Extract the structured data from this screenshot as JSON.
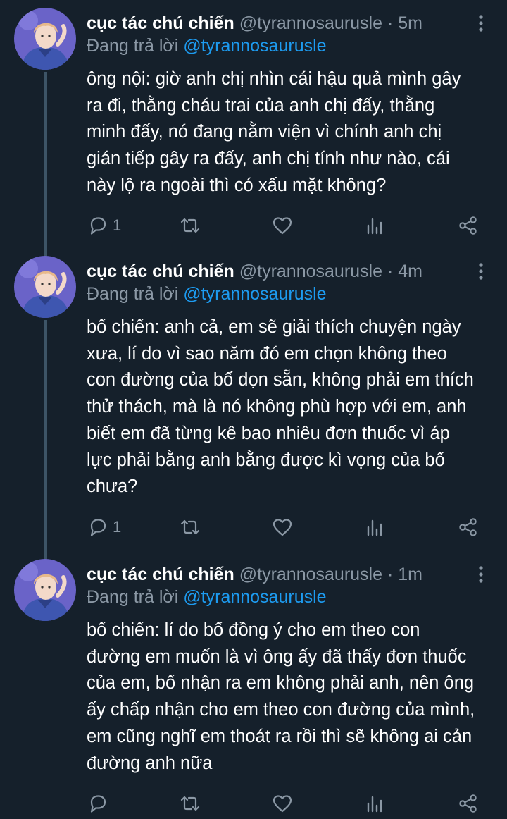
{
  "tweets": [
    {
      "name": "cục tác chú chiến",
      "handle": "@tyrannosaurusle",
      "separator": "·",
      "time": "5m",
      "replying_prefix": "Đang trả lời",
      "replying_to": "@tyrannosaurusle",
      "lines": [
        "ông nội: giờ anh chị nhìn cái hậu quả mình gây",
        "ra đi, thằng cháu trai của anh chị đấy, thằng",
        "minh đấy, nó đang nằm viện vì chính anh chị",
        "gián tiếp gây ra đấy, anh chị tính như nào, cái",
        "này lộ ra ngoài thì có xấu mặt không?"
      ],
      "reply_count": "1"
    },
    {
      "name": "cục tác chú chiến",
      "handle": "@tyrannosaurusle",
      "separator": "·",
      "time": "4m",
      "replying_prefix": "Đang trả lời",
      "replying_to": "@tyrannosaurusle",
      "lines": [
        "bố chiến: anh cả, em sẽ giải thích chuyện ngày",
        "xưa, lí do vì sao năm đó em chọn không theo",
        "con đường của bố dọn sẵn, không phải em thích",
        "thử thách, mà là nó không phù hợp với em, anh",
        "biết em đã từng kê bao nhiêu đơn thuốc vì áp",
        "lực phải bằng anh bằng được kì vọng của bố",
        "chưa?"
      ],
      "reply_count": "1"
    },
    {
      "name": "cục tác chú chiến",
      "handle": "@tyrannosaurusle",
      "separator": "·",
      "time": "1m",
      "replying_prefix": "Đang trả lời",
      "replying_to": "@tyrannosaurusle",
      "lines": [
        "bố chiến: lí do bố đồng ý cho em theo con",
        "đường em muốn là vì ông ấy đã thấy đơn thuốc",
        "của em, bố nhận ra em không phải anh, nên ông",
        "ấy chấp nhận cho em theo con đường của mình,",
        "em cũng nghĩ em thoát ra rồi thì sẽ không ai cản",
        "đường anh nữa"
      ],
      "reply_count": ""
    }
  ],
  "icons": {
    "reply": "reply-icon",
    "retweet": "retweet-icon",
    "like": "heart-icon",
    "analytics": "analytics-icon",
    "share": "share-icon",
    "more": "more-vertical-icon"
  },
  "colors": {
    "background": "#15202b",
    "secondary_text": "#8b98a5",
    "link": "#1d9bf0",
    "thread_line": "#3d5466"
  }
}
